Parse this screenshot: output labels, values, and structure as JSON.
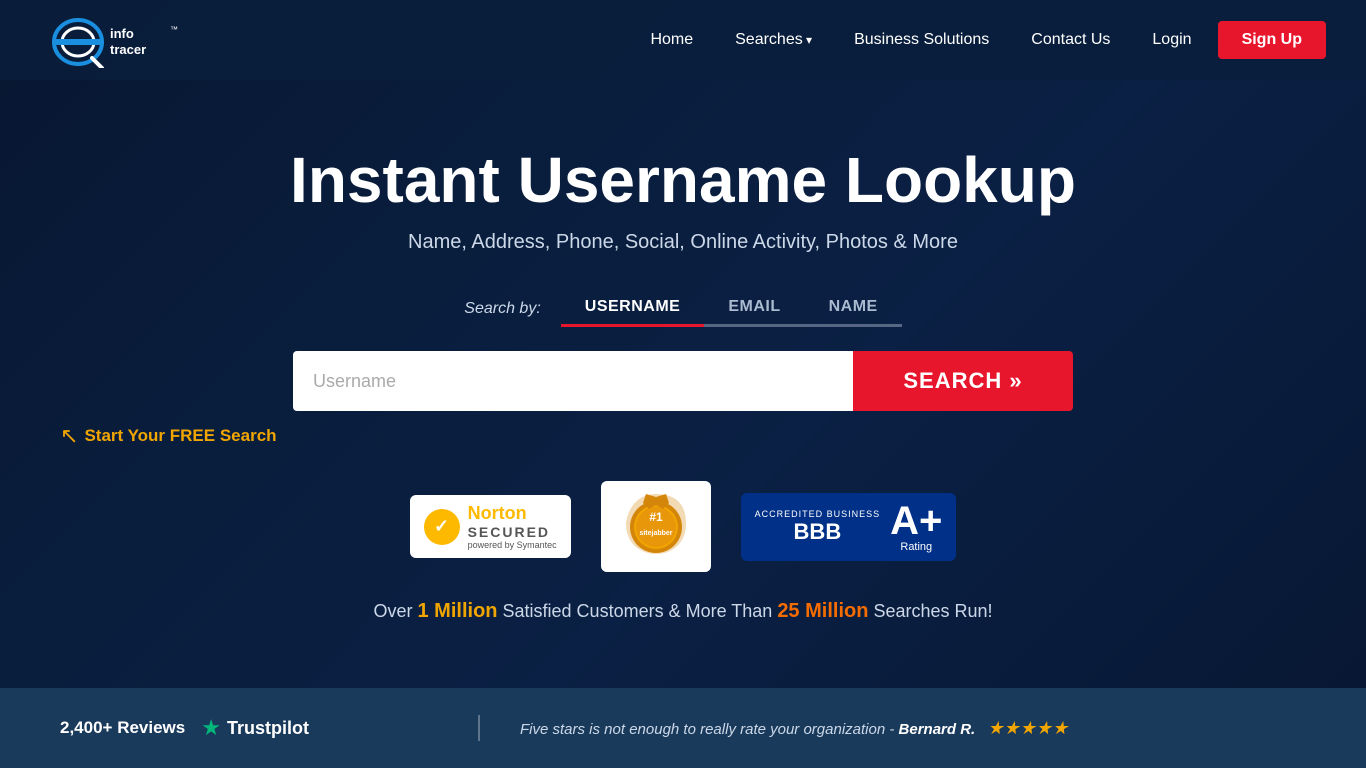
{
  "site": {
    "name": "InfoTracer",
    "tm": "™"
  },
  "nav": {
    "home": "Home",
    "searches": "Searches",
    "business_solutions": "Business Solutions",
    "contact_us": "Contact Us",
    "login": "Login",
    "signup": "Sign Up"
  },
  "hero": {
    "title": "Instant Username Lookup",
    "subtitle": "Name, Address, Phone, Social, Online Activity, Photos & More",
    "search_by_label": "Search by:",
    "tab_username": "USERNAME",
    "tab_email": "EMAIL",
    "tab_name": "NAME",
    "search_placeholder": "Username",
    "search_button": "SEARCH »",
    "free_search_hint": "Start Your FREE Search",
    "stats_text_1": "Over",
    "stats_highlight1": "1 Million",
    "stats_text_2": "Satisfied Customers & More Than",
    "stats_highlight2": "25 Million",
    "stats_text_3": "Searches Run!"
  },
  "badges": {
    "norton": {
      "secured": "SECURED",
      "powered": "powered by Symantec"
    },
    "sitejabber": {
      "rank": "#1",
      "label": "sitejabber"
    },
    "bbb": {
      "accredited": "ACCREDITED BUSINESS",
      "logo": "BBB",
      "grade": "A+",
      "rating": "Rating"
    }
  },
  "footer": {
    "reviews": "2,400+ Reviews",
    "trustpilot": "Trustpilot",
    "quote": "Five stars is not enough to really rate your organization -",
    "author": "Bernard R.",
    "stars": "★★★★★"
  }
}
